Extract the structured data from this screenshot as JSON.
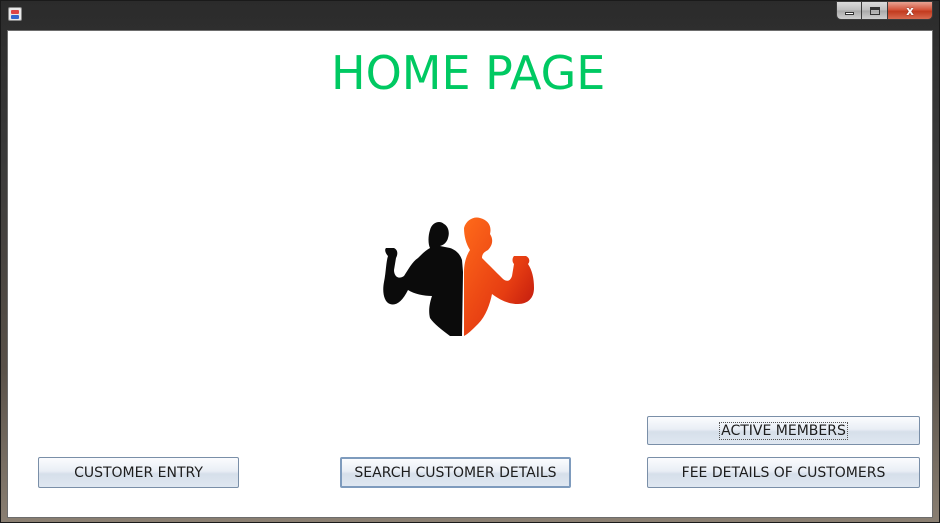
{
  "window": {
    "title": "",
    "controls": {
      "minimize_icon": "minimize-icon",
      "maximize_icon": "maximize-icon",
      "close_icon": "close-icon",
      "close_glyph": "x"
    }
  },
  "page": {
    "title": "HOME PAGE",
    "title_color": "#00c962",
    "logo": "gym-fitness-couple-logo"
  },
  "buttons": {
    "active_members": "ACTIVE MEMBERS",
    "customer_entry": "CUSTOMER ENTRY",
    "search_customer_details": "SEARCH CUSTOMER DETAILS",
    "fee_details": "FEE DETAILS OF CUSTOMERS"
  }
}
